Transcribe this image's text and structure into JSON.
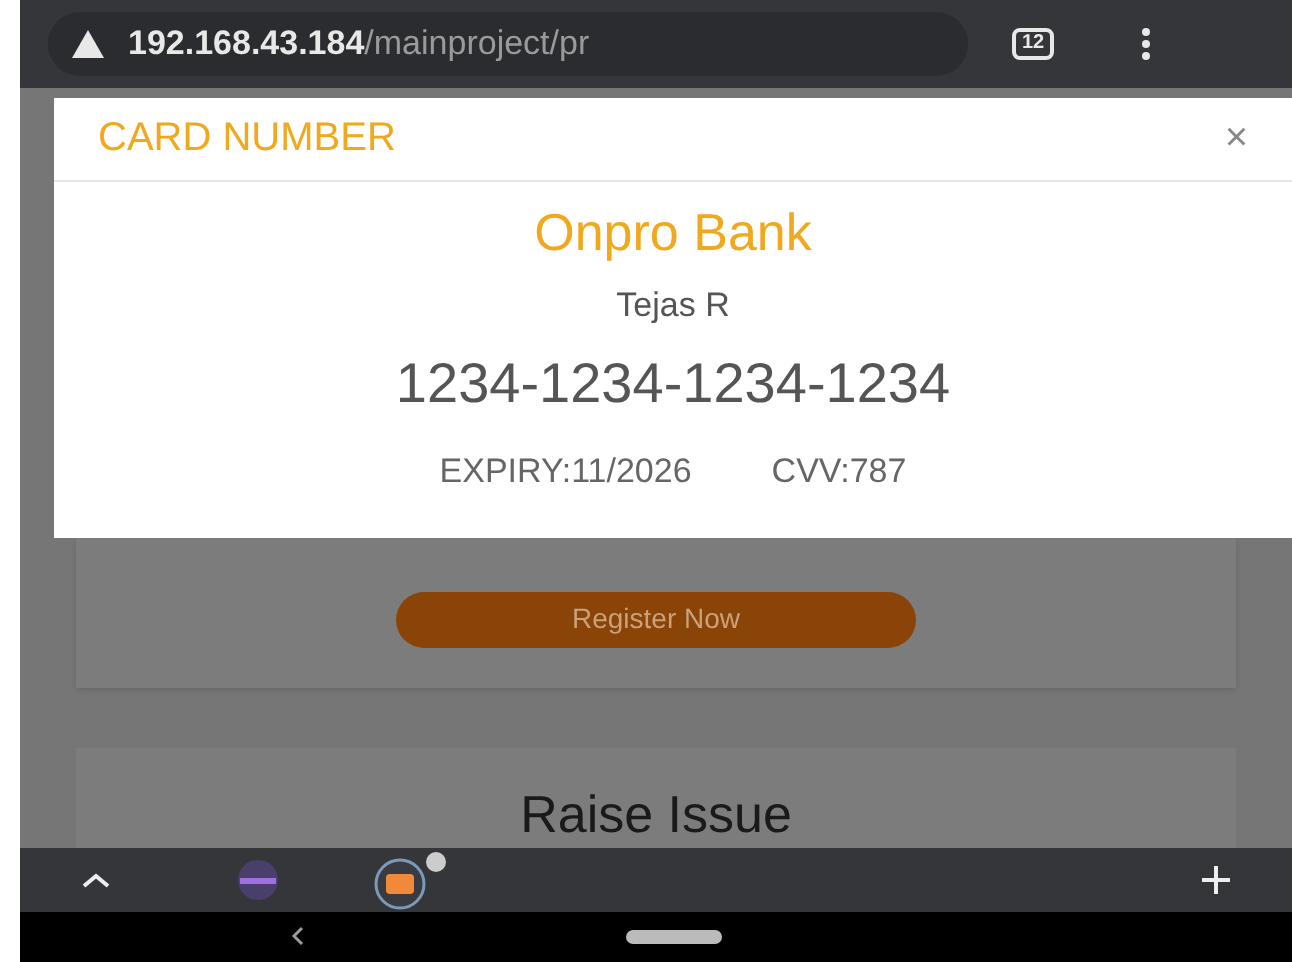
{
  "browser": {
    "url_host": "192.168.43.184",
    "url_path": "/mainproject/pr",
    "tab_count": "12"
  },
  "modal": {
    "title": "CARD NUMBER",
    "close": "×",
    "bank": "Onpro Bank",
    "holder": "Tejas R",
    "card_number": "1234-1234-1234-1234",
    "expiry": "EXPIRY:11/2026",
    "cvv": "CVV:787"
  },
  "cards": [
    {
      "kind": "button",
      "label": "Register Now"
    },
    {
      "kind": "title",
      "label": "Raise Issue"
    }
  ]
}
